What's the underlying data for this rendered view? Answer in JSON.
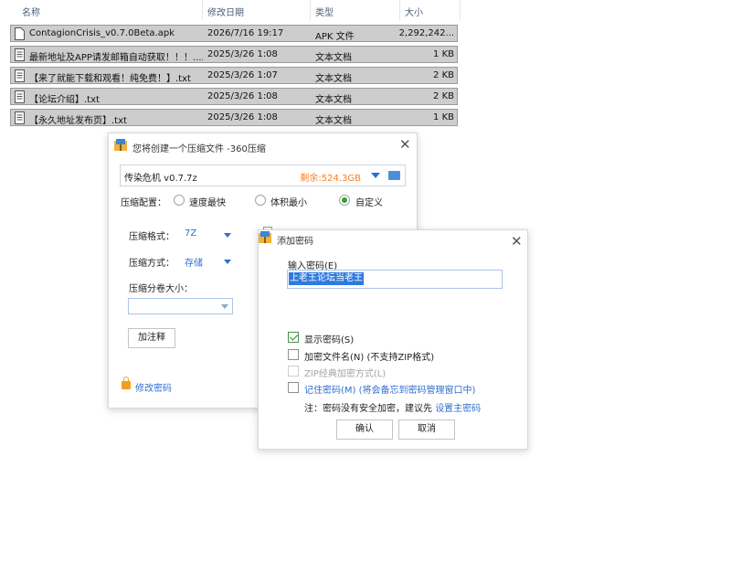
{
  "header": {
    "name": "名称",
    "date": "修改日期",
    "type": "类型",
    "size": "大小"
  },
  "files": [
    {
      "name": "ContagionCrisis_v0.7.0Beta.apk",
      "date": "2026/7/16 19:17",
      "type": "APK 文件",
      "size": "2,292,242..."
    },
    {
      "name": "最新地址及APP请发邮箱自动获取！！！....",
      "date": "2025/3/26 1:08",
      "type": "文本文档",
      "size": "1 KB"
    },
    {
      "name": "【来了就能下载和观看！纯免费！】.txt",
      "date": "2025/3/26 1:07",
      "type": "文本文档",
      "size": "2 KB"
    },
    {
      "name": "【论坛介绍】.txt",
      "date": "2025/3/26 1:08",
      "type": "文本文档",
      "size": "2 KB"
    },
    {
      "name": "【永久地址发布页】.txt",
      "date": "2025/3/26 1:08",
      "type": "文本文档",
      "size": "1 KB"
    }
  ],
  "compress_dialog": {
    "title": "您将创建一个压缩文件 -360压缩",
    "filename": "传染危机  v0.7.7z",
    "free_space": "剩余:524.3GB",
    "config_label": "压缩配置：",
    "options": [
      "速度最快",
      "体积最小",
      "自定义"
    ],
    "selected_option": "自定义",
    "format_label": "压缩格式：",
    "format_value": "7Z",
    "method_label": "压缩方式：",
    "method_value": "存储",
    "volume_label": "压缩分卷大小：",
    "volume_value": "",
    "comment_button": "加注释",
    "change_password": "修改密码"
  },
  "password_dialog": {
    "title": "添加密码",
    "input_label": "输入密码(E)",
    "password_value": "上老王论坛当老王",
    "show_password": "显示密码(S)",
    "encrypt_filenames": "加密文件名(N) (不支持ZIP格式)",
    "zip_classic": "ZIP经典加密方式(L)",
    "remember_password": "记住密码(M) (将会备忘到密码管理窗口中)",
    "note_prefix": "注：密码没有安全加密，建议先 ",
    "note_link": "设置主密码",
    "ok_button": "确认",
    "cancel_button": "取消",
    "show_password_checked": true,
    "encrypt_filenames_checked": false,
    "remember_password_checked": false
  },
  "colors": {
    "accent": "#2f6fd0",
    "free_space": "#ff7a1a",
    "selection": "#2f7ae0"
  }
}
